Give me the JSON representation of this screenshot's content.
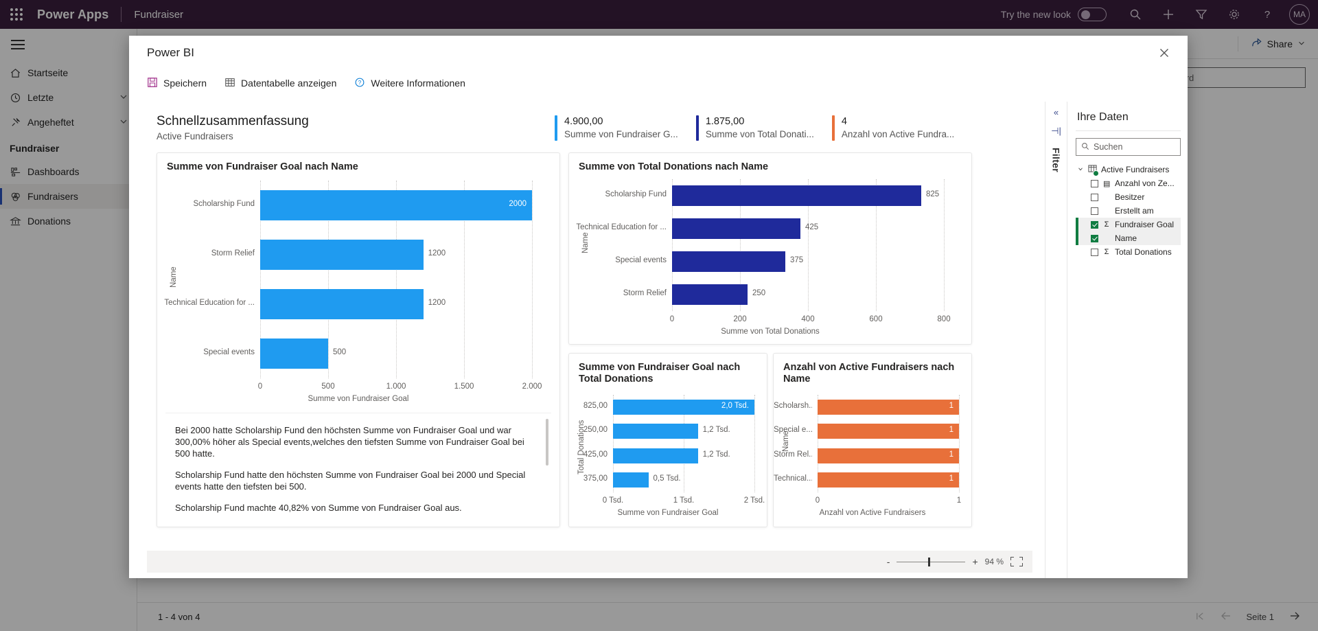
{
  "topbar": {
    "brand": "Power Apps",
    "app_name": "Fundraiser",
    "try_new_look": "Try the new look",
    "avatar_initials": "MA",
    "icons": [
      "waffle-icon",
      "search-icon",
      "plus-icon",
      "filter-icon",
      "gear-icon",
      "help-icon"
    ]
  },
  "sidebar": {
    "items": [
      {
        "label": "Startseite",
        "icon": "home-icon",
        "chevron": false
      },
      {
        "label": "Letzte",
        "icon": "clock-icon",
        "chevron": true
      },
      {
        "label": "Angeheftet",
        "icon": "pin-icon",
        "chevron": true
      }
    ],
    "group_label": "Fundraiser",
    "group_items": [
      {
        "label": "Dashboards",
        "icon": "dashboard-icon",
        "selected": false
      },
      {
        "label": "Fundraisers",
        "icon": "money-icon",
        "selected": true
      },
      {
        "label": "Donations",
        "icon": "bank-icon",
        "selected": false
      }
    ]
  },
  "command_bar": {
    "share_label": "Share",
    "filter_placeholder": "Filter by keyword"
  },
  "pager": {
    "count": "1 - 4 von 4",
    "page_label": "Seite 1"
  },
  "modal": {
    "title": "Power BI",
    "close_icon": "close-icon",
    "toolbar": [
      {
        "label": "Speichern",
        "icon": "save-icon"
      },
      {
        "label": "Datentabelle anzeigen",
        "icon": "table-icon"
      },
      {
        "label": "Weitere Informationen",
        "icon": "info-icon"
      }
    ]
  },
  "report": {
    "summary_title": "Schnellzusammenfassung",
    "summary_subtitle": "Active Fundraisers",
    "kpis": [
      {
        "value": "4.900,00",
        "label": "Summe von Fundraiser G...",
        "color": "#1f9bf0"
      },
      {
        "value": "1.875,00",
        "label": "Summe von Total Donati...",
        "color": "#1f2a9b"
      },
      {
        "value": "4",
        "label": "Anzahl von Active Fundra...",
        "color": "#e8703a"
      }
    ],
    "narrative": [
      "Bei 2000 hatte Scholarship Fund den höchsten Summe von Fundraiser Goal und war 300,00% höher als Special events,welches den tiefsten Summe von Fundraiser Goal bei 500 hatte.",
      "Scholarship Fund hatte den höchsten Summe von Fundraiser Goal bei 2000 und Special events hatte den tiefsten bei 500.",
      "Scholarship Fund machte 40,82% von Summe von Fundraiser Goal aus."
    ],
    "statusbar": {
      "zoom_out": "-",
      "zoom_in": "+",
      "zoom_level": "94 %",
      "fit_icon": "fit-to-page-icon"
    }
  },
  "filter_rail": {
    "collapse_icon": "chevron-double-left-icon",
    "expand_icon": "filter-pane-icon",
    "label": "Filter"
  },
  "data_pane": {
    "title": "Ihre Daten",
    "search_placeholder": "Suchen",
    "table": {
      "label": "Active Fundraisers",
      "icon": "table-icon",
      "expanded": true
    },
    "fields": [
      {
        "label": "Anzahl von Ze...",
        "checked": false,
        "sigma": false,
        "calc_icon": true,
        "active": false
      },
      {
        "label": "Besitzer",
        "checked": false,
        "sigma": false,
        "calc_icon": false,
        "active": false
      },
      {
        "label": "Erstellt am",
        "checked": false,
        "sigma": false,
        "calc_icon": false,
        "active": false
      },
      {
        "label": "Fundraiser Goal",
        "checked": true,
        "sigma": true,
        "calc_icon": false,
        "active": true
      },
      {
        "label": "Name",
        "checked": true,
        "sigma": false,
        "calc_icon": false,
        "active": true
      },
      {
        "label": "Total Donations",
        "checked": false,
        "sigma": true,
        "calc_icon": false,
        "active": false
      }
    ]
  },
  "chart_data": [
    {
      "id": "chart-fundraiser-goal-by-name",
      "type": "bar",
      "orientation": "horizontal",
      "title": "Summe von Fundraiser Goal nach Name",
      "categories": [
        "Scholarship Fund",
        "Storm Relief",
        "Technical Education for ...",
        "Special events"
      ],
      "values": [
        2000,
        1200,
        1200,
        500
      ],
      "value_labels": [
        "2000",
        "1200",
        "1200",
        "500"
      ],
      "label_inside": [
        true,
        false,
        false,
        false
      ],
      "ylabel": "Name",
      "xlabel": "Summe von Fundraiser Goal",
      "xticks": [
        "0",
        "500",
        "1.000",
        "1.500",
        "2.000"
      ],
      "xlim": [
        0,
        2000
      ],
      "color": "#1f9bf0",
      "grid": true,
      "legend": false
    },
    {
      "id": "chart-total-donations-by-name",
      "type": "bar",
      "orientation": "horizontal",
      "title": "Summe von Total Donations nach Name",
      "categories": [
        "Scholarship Fund",
        "Technical Education for ...",
        "Special events",
        "Storm Relief"
      ],
      "values": [
        825,
        425,
        375,
        250
      ],
      "value_labels": [
        "825",
        "425",
        "375",
        "250"
      ],
      "label_inside": [
        false,
        false,
        false,
        false
      ],
      "ylabel": "Name",
      "xlabel": "Summe von Total Donations",
      "xticks": [
        "0",
        "200",
        "400",
        "600",
        "800"
      ],
      "xlim": [
        0,
        900
      ],
      "color": "#1f2a9b",
      "grid": true,
      "legend": false
    },
    {
      "id": "chart-fundraiser-goal-by-total-donations",
      "type": "bar",
      "orientation": "horizontal",
      "title": "Summe von Fundraiser Goal nach Total Donations",
      "categories": [
        "825,00",
        "250,00",
        "425,00",
        "375,00"
      ],
      "values": [
        2000,
        1200,
        1200,
        500
      ],
      "value_labels": [
        "2,0 Tsd.",
        "1,2 Tsd.",
        "1,2 Tsd.",
        "0,5 Tsd."
      ],
      "label_inside": [
        true,
        false,
        false,
        false
      ],
      "ylabel": "Total Donations",
      "xlabel": "Summe von Fundraiser Goal",
      "xticks": [
        "0 Tsd.",
        "1 Tsd.",
        "2 Tsd."
      ],
      "xlim": [
        0,
        2000
      ],
      "color": "#1f9bf0",
      "grid": true,
      "legend": false
    },
    {
      "id": "chart-active-fundraisers-by-name",
      "type": "bar",
      "orientation": "horizontal",
      "title": "Anzahl von Active Fundraisers nach Name",
      "categories": [
        "Scholarsh...",
        "Special e...",
        "Storm Rel...",
        "Technical..."
      ],
      "values": [
        1,
        1,
        1,
        1
      ],
      "value_labels": [
        "1",
        "1",
        "1",
        "1"
      ],
      "label_inside": [
        true,
        true,
        true,
        true
      ],
      "ylabel": "Name",
      "xlabel": "Anzahl von Active Fundraisers",
      "xticks": [
        "0",
        "1"
      ],
      "xlim": [
        0,
        1
      ],
      "color": "#e8703a",
      "grid": true,
      "legend": false
    }
  ]
}
